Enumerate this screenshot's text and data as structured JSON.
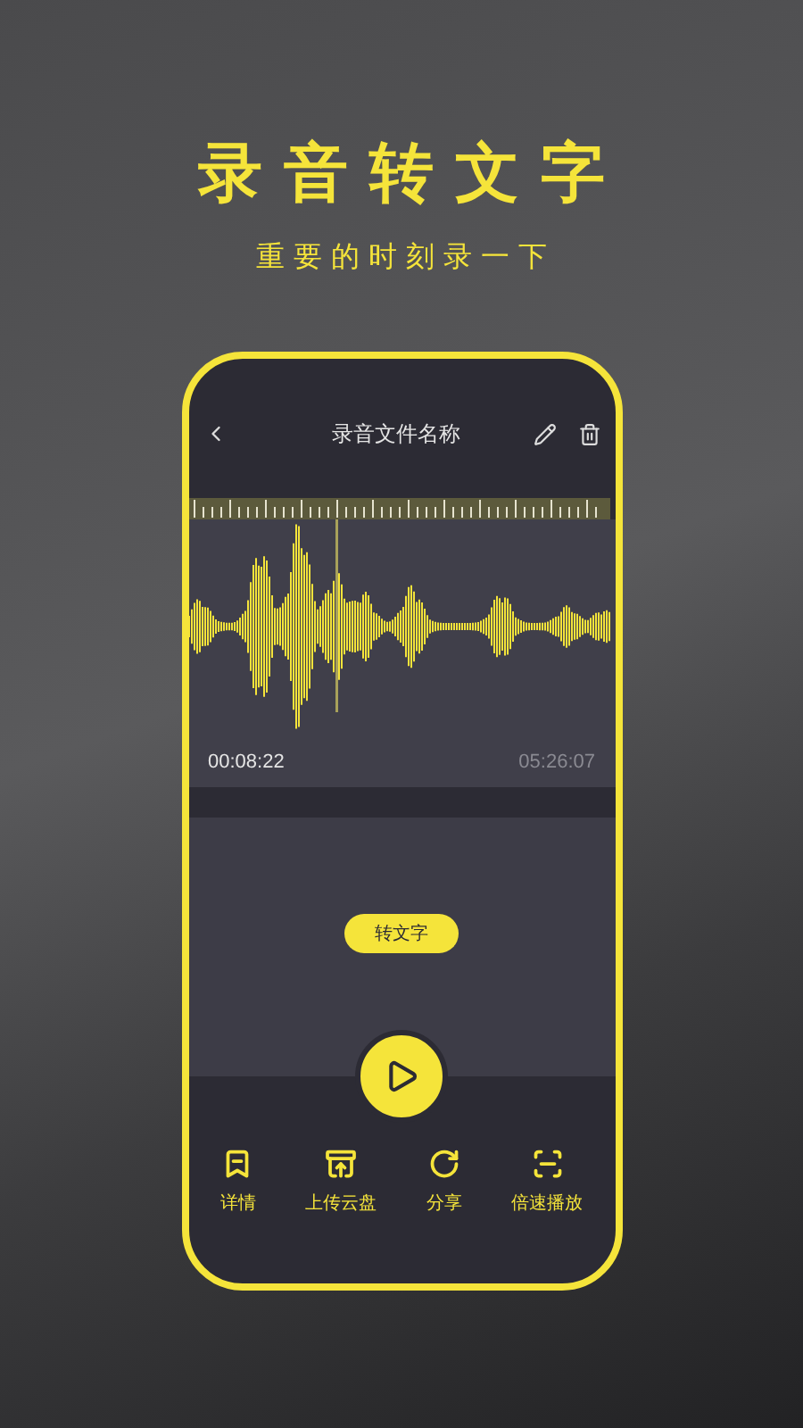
{
  "headline": "录音转文字",
  "subtitle": "重要的时刻录一下",
  "screen": {
    "title": "录音文件名称",
    "current_time": "00:08:22",
    "total_time": "05:26:07",
    "convert_button": "转文字"
  },
  "nav": [
    {
      "kind": "details",
      "label": "详情"
    },
    {
      "kind": "upload",
      "label": "上传云盘"
    },
    {
      "kind": "share",
      "label": "分享"
    },
    {
      "kind": "speed",
      "label": "倍速播放"
    }
  ]
}
